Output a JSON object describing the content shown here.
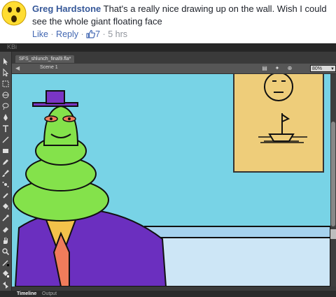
{
  "comment": {
    "author": "Greg Hardstone",
    "text": " That's a really nice drawing up on the wall. Wish I could see the whole giant floating face",
    "actions": {
      "like": "Like",
      "separator": " · ",
      "reply": "Reply",
      "like_count": "7",
      "time": "5 hrs"
    }
  },
  "editor": {
    "top_faded_text": "KBi",
    "document_tab": "SFS_shlunch_final9.fla*",
    "scene_label": "Scene 1",
    "zoom_value": "80%",
    "bottom_tabs": [
      "Timeline",
      "Output"
    ]
  },
  "colors": {
    "facebook_link": "#365899",
    "stage_sky": "#78d3e6",
    "wall_lower": "#a6d2ee",
    "picture_frame": "#eecd7a",
    "character_green": "#84e24b",
    "hat_purple": "#7a35c4",
    "suit_purple": "#6b2fbf",
    "tie_orange": "#f07c5b",
    "shirt_yellow": "#f3c24a"
  }
}
